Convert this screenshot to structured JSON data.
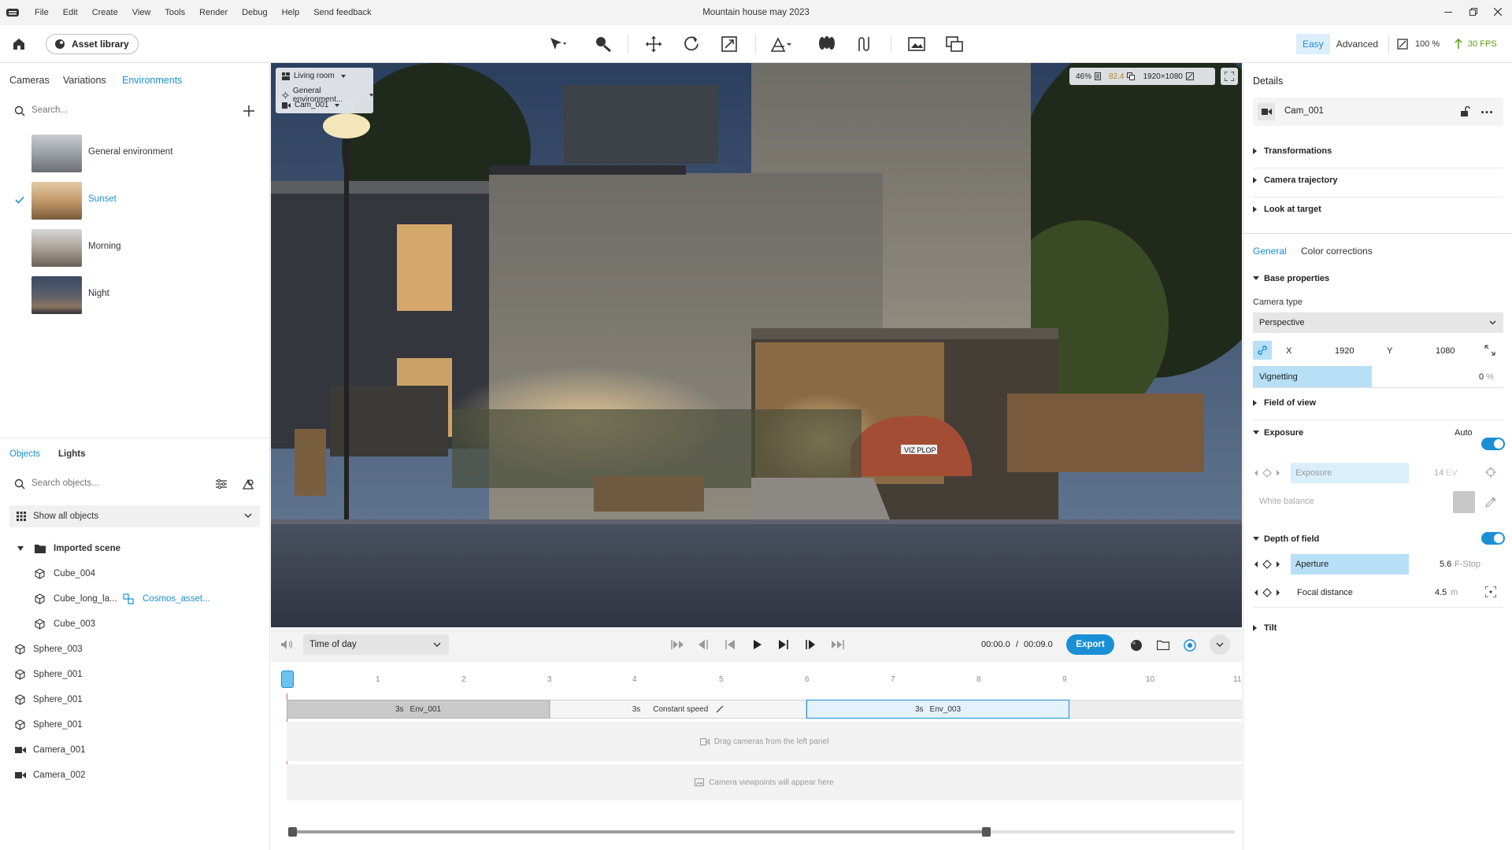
{
  "app": {
    "title": "Mountain house may 2023"
  },
  "menu": [
    "File",
    "Edit",
    "Create",
    "View",
    "Tools",
    "Render",
    "Debug",
    "Help",
    "Send feedback"
  ],
  "toolbar": {
    "asset_library": "Asset library",
    "mode_easy": "Easy",
    "mode_advanced": "Advanced",
    "zoom": "100 %",
    "fps": "30 FPS"
  },
  "left": {
    "tabs": [
      "Cameras",
      "Variations",
      "Environments"
    ],
    "search_placeholder": "Search...",
    "environments": [
      {
        "label": "General environment",
        "selected": false
      },
      {
        "label": "Sunset",
        "selected": true
      },
      {
        "label": "Morning",
        "selected": false
      },
      {
        "label": "Night",
        "selected": false
      }
    ],
    "objects_tabs": [
      "Objects",
      "Lights"
    ],
    "objects_search_placeholder": "Search objects...",
    "filter_label": "Show all objects",
    "tree": [
      {
        "label": "Imported scene",
        "icon": "folder-icon",
        "bold": true
      },
      {
        "label": "Cube_004",
        "icon": "cube-icon"
      },
      {
        "label": "Cube_long_la...",
        "icon": "cube-icon",
        "link": "Cosmos_asset..."
      },
      {
        "label": "Cube_003",
        "icon": "cube-icon"
      },
      {
        "label": "Sphere_003",
        "icon": "cube-icon"
      },
      {
        "label": "Sphere_001",
        "icon": "cube-icon"
      },
      {
        "label": "Sphere_001",
        "icon": "cube-icon"
      },
      {
        "label": "Sphere_001",
        "icon": "cube-icon"
      },
      {
        "label": "Camera_001",
        "icon": "camera-icon"
      },
      {
        "label": "Camera_002",
        "icon": "camera-icon"
      }
    ]
  },
  "viewport": {
    "room": "Living room",
    "environment": "General environment...",
    "camera": "Cam_001",
    "stat_percent": "46%",
    "stat_value": "82.4",
    "resolution": "1920×1080",
    "plate": "VIZ PLOP"
  },
  "timeline": {
    "time_of_day": "Time of day",
    "current_time": "00:00.0",
    "separator": "/",
    "total_time": "00:09.0",
    "export": "Export",
    "ruler": [
      "1",
      "2",
      "3",
      "4",
      "5",
      "6",
      "7",
      "8",
      "9",
      "10",
      "11"
    ],
    "clips": [
      {
        "duration": "3s",
        "label": "Env_001"
      },
      {
        "duration": "3s",
        "label": "Constant speed"
      },
      {
        "duration": "3s",
        "label": "Env_003"
      }
    ],
    "drag_hint": "Drag cameras from the left panel",
    "viewpoints_hint": "Camera viewpoints will appear here"
  },
  "right": {
    "details_title": "Details",
    "camera_name": "Cam_001",
    "sections": [
      "Transformations",
      "Camera trajectory",
      "Look at target"
    ],
    "tabs": [
      "General",
      "Color corrections"
    ],
    "base_properties": "Base properties",
    "camera_type_label": "Camera type",
    "camera_type_value": "Perspective",
    "x_label": "X",
    "x_value": "1920",
    "y_label": "Y",
    "y_value": "1080",
    "vignetting_label": "Vignetting",
    "vignetting_value": "0",
    "vignetting_unit": "%",
    "field_of_view": "Field of view",
    "exposure_section": "Exposure",
    "auto_label": "Auto",
    "exposure_label": "Exposure",
    "exposure_value": "14",
    "exposure_unit": "EV",
    "white_balance": "White balance",
    "dof_section": "Depth of field",
    "aperture_label": "Aperture",
    "aperture_value": "5.6",
    "aperture_unit": "F-Stop",
    "focal_label": "Focal distance",
    "focal_value": "4.5",
    "focal_unit": "m",
    "tilt": "Tilt"
  },
  "colors": {
    "accent": "#1a8fd6",
    "highlight": "#b7e0f7",
    "fps_green": "#5a9a17"
  }
}
